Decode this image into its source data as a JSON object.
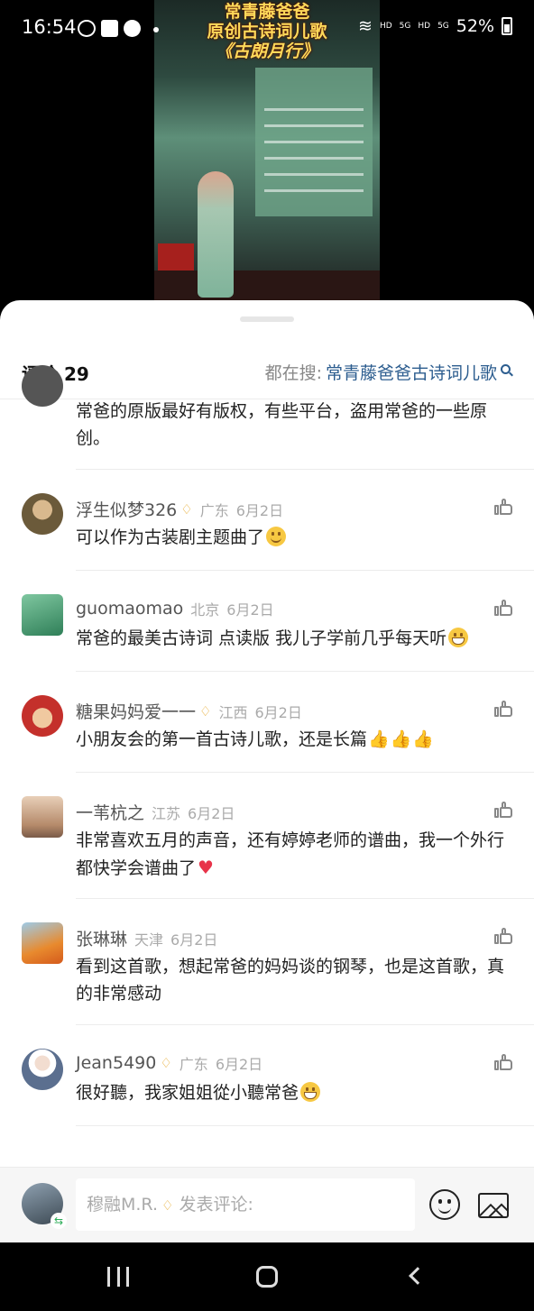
{
  "status_bar": {
    "time": "16:54",
    "battery": "52%",
    "net1": "HD",
    "net2": "HD",
    "sig1": "5G",
    "sig2": "5G"
  },
  "video": {
    "title_line1": "常青藤爸爸",
    "title_line2": "原创古诗词儿歌",
    "title_line3": "《古朗月行》"
  },
  "header": {
    "comment_count": "评论 29",
    "search_label": "都在搜:",
    "search_term": "常青藤爸爸古诗词儿歌"
  },
  "comments": [
    {
      "text": "常爸的原版最好有版权，有些平台，盗用常爸的一些原创。"
    },
    {
      "user": "浮生似梦326",
      "location": "广东",
      "date": "6月2日",
      "text": "可以作为古装剧主题曲了"
    },
    {
      "user": "guomaomao",
      "location": "北京",
      "date": "6月2日",
      "text": "常爸的最美古诗词 点读版 我儿子学前几乎每天听"
    },
    {
      "user": "糖果妈妈爱一一",
      "location": "江西",
      "date": "6月2日",
      "text": "小朋友会的第一首古诗儿歌，还是长篇"
    },
    {
      "user": "一苇杭之",
      "location": "江苏",
      "date": "6月2日",
      "text": "非常喜欢五月的声音，还有婷婷老师的谱曲，我一个外行都快学会谱曲了"
    },
    {
      "user": "张琳琳",
      "location": "天津",
      "date": "6月2日",
      "text": "看到这首歌，想起常爸的妈妈谈的钢琴，也是这首歌，真的非常感动"
    },
    {
      "user": "Jean5490",
      "location": "广东",
      "date": "6月2日",
      "text": "很好聽，我家姐姐從小聽常爸"
    }
  ],
  "input": {
    "username": "穆融M.R.",
    "placeholder": "发表评论:"
  },
  "colors": {
    "link": "#2c5d8f",
    "vip": "#e5a624",
    "title_gold": "#ffd95a"
  }
}
